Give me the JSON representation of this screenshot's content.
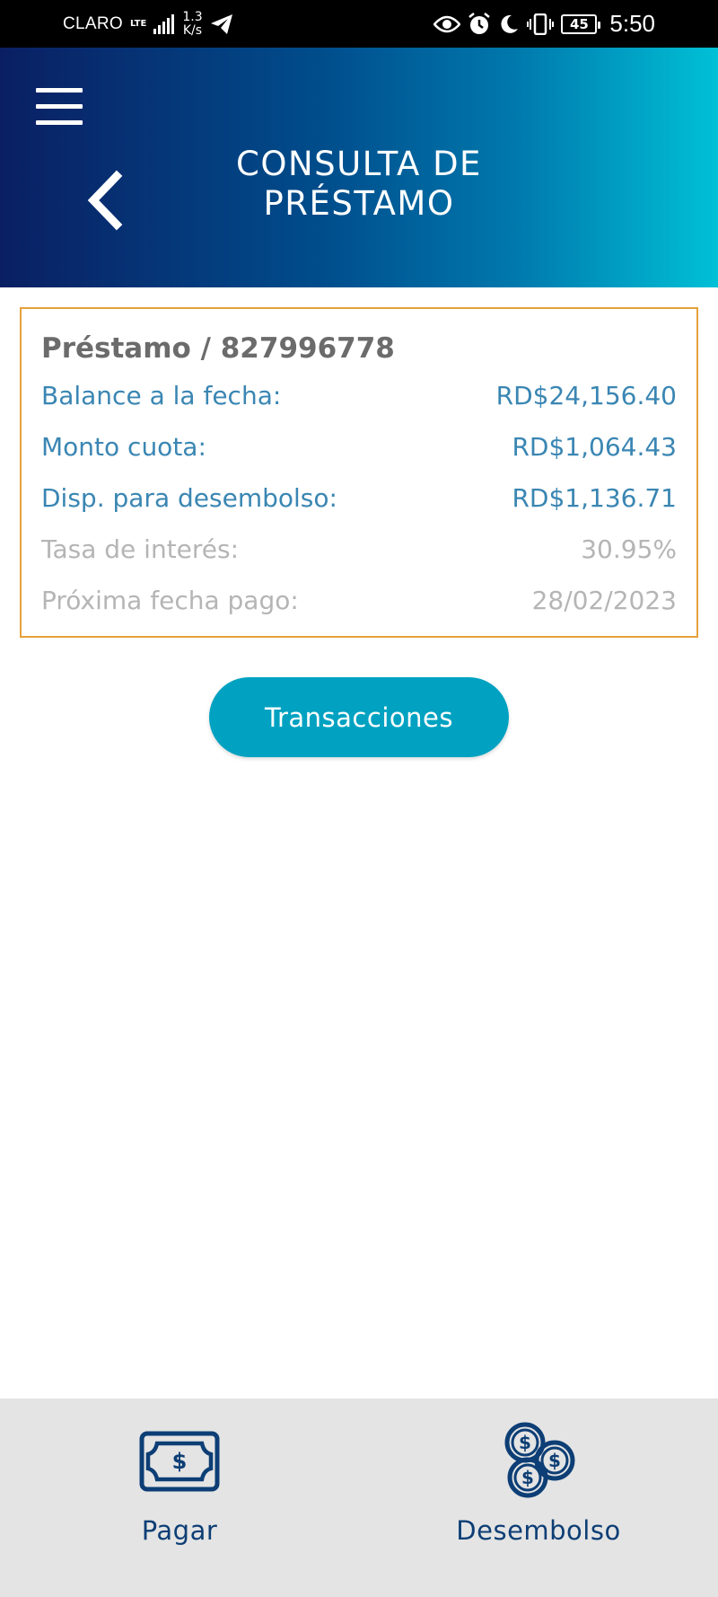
{
  "status_bar": {
    "carrier": "CLARO",
    "network": "LTE",
    "speed_value": "1.3",
    "speed_unit": "K/s",
    "battery": "45",
    "time": "5:50"
  },
  "header": {
    "title": "CONSULTA DE PRÉSTAMO",
    "menu_icon": "hamburger-menu-icon",
    "back_icon": "chevron-left-icon"
  },
  "loan": {
    "title": "Préstamo / 827996778",
    "rows": [
      {
        "label": "Balance a la fecha:",
        "value": "RD$24,156.40"
      },
      {
        "label": "Monto cuota:",
        "value": "RD$1,064.43"
      },
      {
        "label": "Disp. para desembolso:",
        "value": "RD$1,136.71"
      },
      {
        "label": "Tasa de interés:",
        "value": "30.95%"
      },
      {
        "label": "Próxima fecha pago:",
        "value": "28/02/2023"
      }
    ]
  },
  "actions": {
    "transactions_label": "Transacciones"
  },
  "bottom_nav": {
    "items": [
      {
        "label": "Pagar",
        "icon": "banknote-icon"
      },
      {
        "label": "Desembolso",
        "icon": "coins-icon"
      }
    ]
  },
  "colors": {
    "header_gradient_start": "#0a1f63",
    "header_gradient_end": "#00c0d6",
    "card_border": "#e6a13b",
    "primary_text": "#3a86b3",
    "secondary_text": "#b5b5b5",
    "button": "#01a2c1",
    "nav_text": "#0d3e75",
    "nav_background": "#e4e4e4"
  }
}
